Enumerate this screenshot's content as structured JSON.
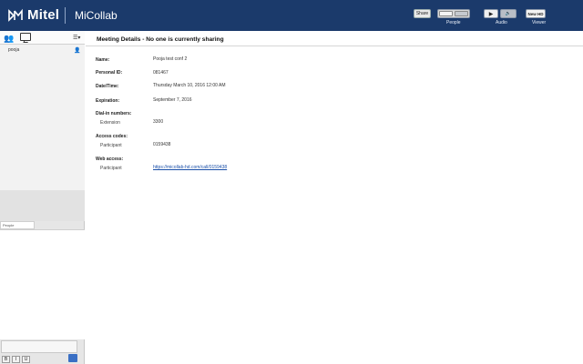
{
  "header": {
    "brand": "Mitel",
    "app_name": "MiCollab",
    "share_label": "Share",
    "people_caption": "People",
    "audio_caption": "Audio",
    "newhd_label": "New HD",
    "viewer_caption": "Viewer"
  },
  "sidebar": {
    "participant_name": "pooja",
    "chat_tab_label": "People",
    "format_buttons": [
      "B",
      "I",
      "U"
    ]
  },
  "main": {
    "title": "Meeting Details - No one is currently sharing",
    "fields": {
      "name_label": "Name:",
      "name_value": "Pooja test conf 2",
      "personal_id_label": "Personal ID:",
      "personal_id_value": "081467",
      "datetime_label": "Date/Time:",
      "datetime_value": "Thursday March 10, 2016 12:00 AM",
      "expiration_label": "Expiration:",
      "expiration_value": "September 7, 2016",
      "dialin_label": "Dial-in numbers:",
      "extension_label": "Extension",
      "extension_value": "3300",
      "access_label": "Access codes:",
      "access_participant_label": "Participant",
      "access_participant_value": "0159438",
      "web_label": "Web access:",
      "web_participant_label": "Participant",
      "web_participant_value": "https://micollab-hd.com/call/0159438"
    }
  }
}
